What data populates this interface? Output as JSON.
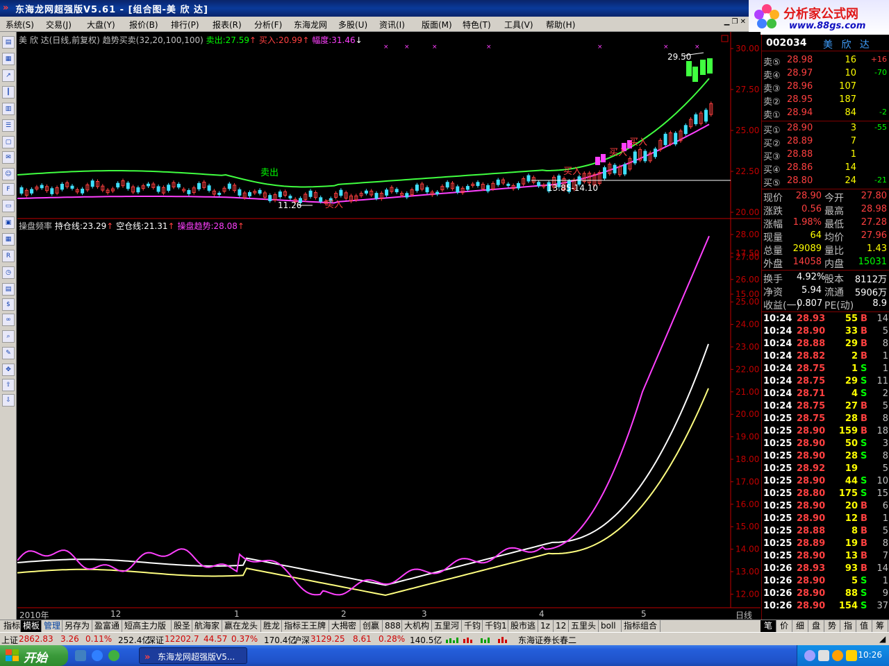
{
  "window": {
    "title": "东海龙网超强版V5.61 - [组合图-美 欣 达]"
  },
  "logo": {
    "name": "分析家公式网",
    "url": "www.88gs.com"
  },
  "menu": [
    "系统(S)",
    "交易(J)",
    "大盘(Y)",
    "报价(B)",
    "排行(P)",
    "报表(R)",
    "分析(F)",
    "东海龙网",
    "多股(U)",
    "资讯(I)",
    "版面(M)",
    "特色(T)",
    "工具(V)",
    "帮助(H)"
  ],
  "price_panel": {
    "header_name": "美 欣 达(日线,前复权)",
    "header_indicator": "趋势买卖(32,20,100,100)",
    "sell_label": "卖出:27.59",
    "buy_label": "买入:20.99",
    "range_label": "幅度:31.46",
    "axis_ticks": [
      "30.00",
      "27.50",
      "25.00",
      "22.50",
      "20.00",
      "17.50",
      "15.00"
    ],
    "annotations": {
      "high": "29.50",
      "low": "11.26",
      "range": "13.85-14.10",
      "sell_signal": "卖出",
      "buy_signal": "买入"
    }
  },
  "indicator_panel": {
    "name": "操盘频率",
    "hold_line": "持仓线:23.29",
    "empty_line": "空仓线:21.31",
    "trend": "操盘趋势:28.08",
    "axis_ticks": [
      "28.00",
      "27.00",
      "26.00",
      "25.00",
      "24.00",
      "23.00",
      "22.00",
      "21.00",
      "20.00",
      "19.00",
      "18.00",
      "17.00",
      "16.00",
      "15.00",
      "14.00",
      "13.00",
      "12.00"
    ]
  },
  "x_axis": {
    "labels": [
      "2010年",
      "12",
      "1",
      "2",
      "3",
      "4",
      "5"
    ],
    "period": "日线"
  },
  "quote": {
    "code": "002034",
    "name": "美 欣 达",
    "asks": [
      {
        "label": "卖⑤",
        "price": "28.98",
        "vol": "16",
        "chg": "+16"
      },
      {
        "label": "卖④",
        "price": "28.97",
        "vol": "10",
        "chg": "-70"
      },
      {
        "label": "卖③",
        "price": "28.96",
        "vol": "107",
        "chg": ""
      },
      {
        "label": "卖②",
        "price": "28.95",
        "vol": "187",
        "chg": ""
      },
      {
        "label": "卖①",
        "price": "28.94",
        "vol": "84",
        "chg": "-2"
      }
    ],
    "bids": [
      {
        "label": "买①",
        "price": "28.90",
        "vol": "3",
        "chg": "-55"
      },
      {
        "label": "买②",
        "price": "28.89",
        "vol": "7",
        "chg": ""
      },
      {
        "label": "买③",
        "price": "28.88",
        "vol": "1",
        "chg": ""
      },
      {
        "label": "买④",
        "price": "28.86",
        "vol": "14",
        "chg": ""
      },
      {
        "label": "买⑤",
        "price": "28.80",
        "vol": "24",
        "chg": "-21"
      }
    ],
    "stats": [
      {
        "l1": "现价",
        "v1": "28.90",
        "l2": "今开",
        "v2": "27.80",
        "c1": "#ff4040",
        "c2": "#ff4040"
      },
      {
        "l1": "涨跌",
        "v1": "0.56",
        "l2": "最高",
        "v2": "28.98",
        "c1": "#ff4040",
        "c2": "#ff4040"
      },
      {
        "l1": "涨幅",
        "v1": "1.98%",
        "l2": "最低",
        "v2": "27.28",
        "c1": "#ff4040",
        "c2": "#ff4040"
      },
      {
        "l1": "现量",
        "v1": "64",
        "l2": "均价",
        "v2": "27.96",
        "c1": "#ffff00",
        "c2": "#ff4040"
      },
      {
        "l1": "总量",
        "v1": "29089",
        "l2": "量比",
        "v2": "1.43",
        "c1": "#ffff00",
        "c2": "#ffff00"
      },
      {
        "l1": "外盘",
        "v1": "14058",
        "l2": "内盘",
        "v2": "15031",
        "c1": "#ff4040",
        "c2": "#00ff00"
      }
    ],
    "stats2": [
      {
        "l1": "换手",
        "v1": "4.92%",
        "l2": "股本",
        "v2": "8112万"
      },
      {
        "l1": "净资",
        "v1": "5.94",
        "l2": "流通",
        "v2": "5906万"
      },
      {
        "l1": "收益(一)",
        "v1": "0.807",
        "l2": "PE(动)",
        "v2": "8.9"
      }
    ],
    "ticks": [
      {
        "t": "10:24",
        "p": "28.93",
        "v": "55",
        "d": "B",
        "n": "14"
      },
      {
        "t": "10:24",
        "p": "28.90",
        "v": "33",
        "d": "B",
        "n": "5"
      },
      {
        "t": "10:24",
        "p": "28.88",
        "v": "29",
        "d": "B",
        "n": "8"
      },
      {
        "t": "10:24",
        "p": "28.82",
        "v": "2",
        "d": "B",
        "n": "1"
      },
      {
        "t": "10:24",
        "p": "28.75",
        "v": "1",
        "d": "S",
        "n": "1"
      },
      {
        "t": "10:24",
        "p": "28.75",
        "v": "29",
        "d": "S",
        "n": "11"
      },
      {
        "t": "10:24",
        "p": "28.71",
        "v": "4",
        "d": "S",
        "n": "2"
      },
      {
        "t": "10:24",
        "p": "28.75",
        "v": "27",
        "d": "B",
        "n": "5"
      },
      {
        "t": "10:25",
        "p": "28.75",
        "v": "28",
        "d": "B",
        "n": "8"
      },
      {
        "t": "10:25",
        "p": "28.90",
        "v": "159",
        "d": "B",
        "n": "18"
      },
      {
        "t": "10:25",
        "p": "28.90",
        "v": "50",
        "d": "S",
        "n": "3"
      },
      {
        "t": "10:25",
        "p": "28.90",
        "v": "28",
        "d": "S",
        "n": "8"
      },
      {
        "t": "10:25",
        "p": "28.92",
        "v": "19",
        "d": "",
        "n": "5"
      },
      {
        "t": "10:25",
        "p": "28.90",
        "v": "44",
        "d": "S",
        "n": "10"
      },
      {
        "t": "10:25",
        "p": "28.80",
        "v": "175",
        "d": "S",
        "n": "15"
      },
      {
        "t": "10:25",
        "p": "28.90",
        "v": "20",
        "d": "B",
        "n": "6"
      },
      {
        "t": "10:25",
        "p": "28.90",
        "v": "12",
        "d": "B",
        "n": "1"
      },
      {
        "t": "10:25",
        "p": "28.88",
        "v": "8",
        "d": "B",
        "n": "5"
      },
      {
        "t": "10:25",
        "p": "28.89",
        "v": "19",
        "d": "B",
        "n": "8"
      },
      {
        "t": "10:25",
        "p": "28.90",
        "v": "13",
        "d": "B",
        "n": "7"
      },
      {
        "t": "10:26",
        "p": "28.93",
        "v": "93",
        "d": "B",
        "n": "14"
      },
      {
        "t": "10:26",
        "p": "28.90",
        "v": "5",
        "d": "S",
        "n": "1"
      },
      {
        "t": "10:26",
        "p": "28.90",
        "v": "88",
        "d": "S",
        "n": "9"
      },
      {
        "t": "10:26",
        "p": "28.90",
        "v": "154",
        "d": "S",
        "n": "37"
      }
    ]
  },
  "tabs": [
    "指标",
    "模板",
    "管理",
    "另存为",
    "盈富通",
    "短高主力版",
    "股圣",
    "航海家",
    "赢在龙头",
    "胜龙",
    "指标王王牌",
    "大揭密",
    "创赢",
    "888",
    "大机构",
    "五里河",
    "千钧",
    "千钧1",
    "股市逃",
    "1z",
    "12",
    "五里头",
    "boll",
    "指标组合"
  ],
  "right_tabs": [
    "笔",
    "价",
    "细",
    "盘",
    "势",
    "指",
    "值",
    "筹"
  ],
  "status": {
    "sh_label": "上证",
    "sh_index": "2862.83",
    "sh_chg": "3.26",
    "sh_pct": "0.11%",
    "sh_amt": "252.4亿",
    "sz_label": "深证",
    "sz_index": "12202.7",
    "sz_chg": "44.57",
    "sz_pct": "0.37%",
    "sz_amt": "170.4亿",
    "hs_label": "沪深",
    "hs_index": "3129.25",
    "hs_chg": "8.61",
    "hs_pct": "0.28%",
    "hs_amt": "140.5亿",
    "broker": "东海证券长春二"
  },
  "taskbar": {
    "start": "开始",
    "task": "东海龙网超强版V5...",
    "clock": "10:26"
  },
  "colors": {
    "up": "#ff4040",
    "down": "#00ff00",
    "magenta": "#ff40ff",
    "axis": "#c00000"
  }
}
